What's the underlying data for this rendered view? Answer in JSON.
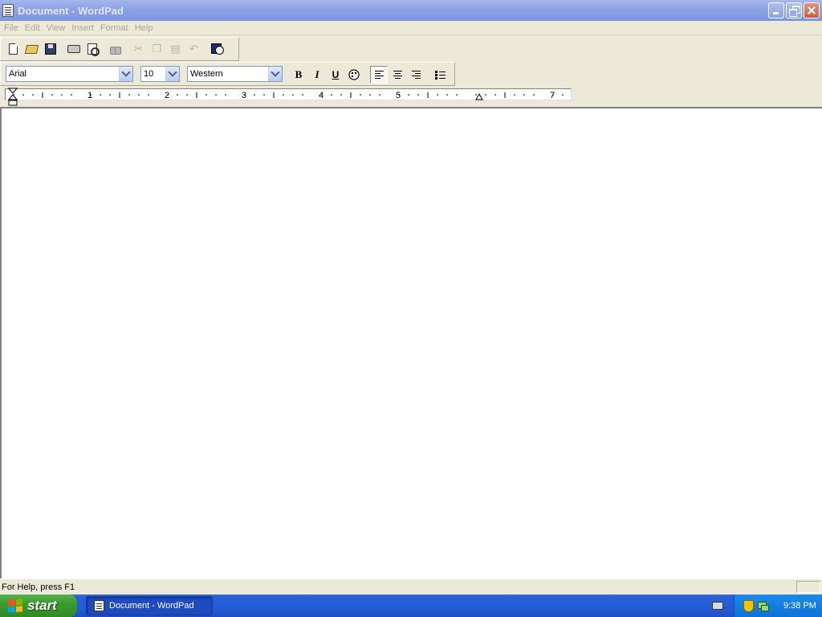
{
  "window": {
    "title": "Document - WordPad"
  },
  "menu": [
    "File",
    "Edit",
    "View",
    "Insert",
    "Format",
    "Help"
  ],
  "toolbar": {
    "buttons": [
      "new-icon",
      "open-icon",
      "save-icon",
      "print-icon",
      "print-preview-icon",
      "find-icon",
      "cut-icon",
      "copy-icon",
      "paste-icon",
      "undo-icon",
      "date-time-icon"
    ]
  },
  "format_bar": {
    "font": "Arial",
    "size": "10",
    "script": "Western",
    "bold": "B",
    "italic": "I",
    "underline": "U"
  },
  "ruler": {
    "labels": [
      "1",
      "2",
      "3",
      "4",
      "5",
      "7"
    ]
  },
  "status": {
    "message": "For Help, press F1"
  },
  "taskbar": {
    "start_label": "start",
    "task_label": "Document - WordPad",
    "clock": "9:38 PM"
  },
  "colors": {
    "title_bar": "#8ea3e6",
    "taskbar": "#245edb",
    "start_button": "#3a9a2f",
    "tray": "#0e73d8"
  }
}
